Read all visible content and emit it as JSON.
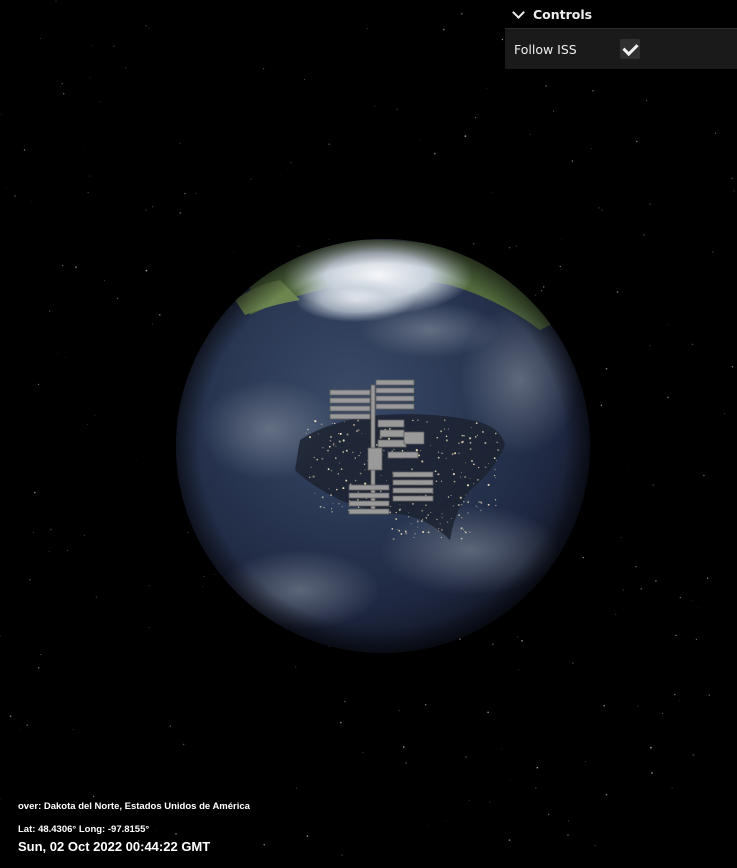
{
  "controls": {
    "title": "Controls",
    "follow_iss": {
      "label": "Follow ISS",
      "checked": true
    }
  },
  "info": {
    "over_prefix": "over:",
    "over_place": "Dakota del Norte, Estados Unidos de América",
    "lat_label": "Lat:",
    "lat_value": "48.4306°",
    "long_label": "Long:",
    "long_value": "-97.8155°",
    "datetime": "Sun, 02 Oct 2022 00:44:22 GMT"
  },
  "icons": {
    "controls_toggle": "chevron-down-icon",
    "checkbox": "check-icon"
  },
  "colors": {
    "background": "#000000",
    "panel": "#1a1a1a",
    "panel_header": "#000000",
    "checkbox_bg": "#303030",
    "ocean": "#2a3d5e",
    "ice": "#e6ebf0",
    "land": "#5f7a45",
    "city_lights": "#fff1c8",
    "iss_gray": "#9a9a9a"
  }
}
